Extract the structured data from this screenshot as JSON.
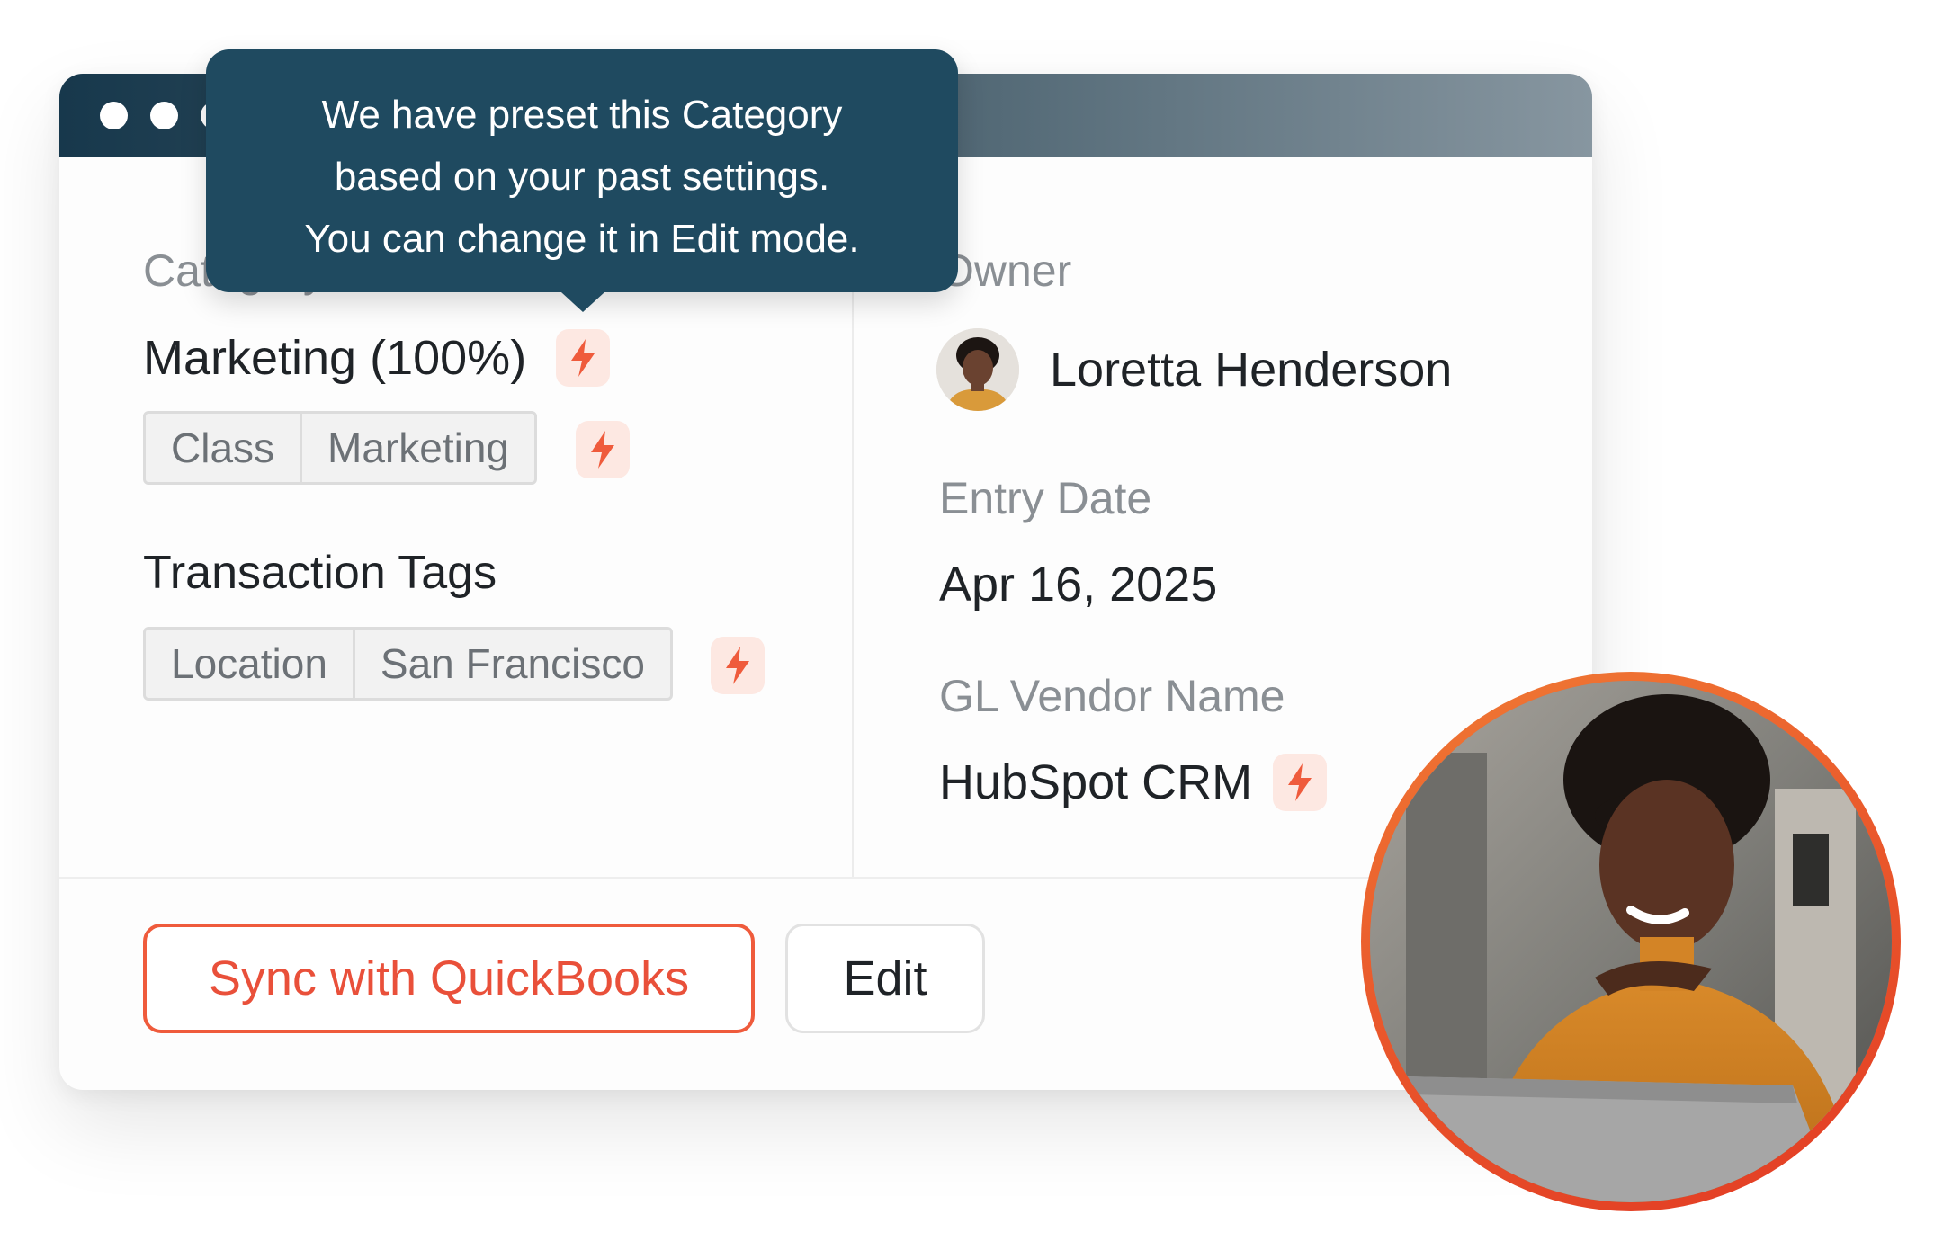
{
  "tooltip": {
    "line1": "We have preset this Category",
    "line2": "based on your past settings.",
    "line3": "You can change it in Edit mode."
  },
  "left": {
    "category_label": "Category",
    "category_value": "Marketing (100%)",
    "class_chip": {
      "key": "Class",
      "value": "Marketing"
    },
    "transaction_tags_title": "Transaction Tags",
    "location_chip": {
      "key": "Location",
      "value": "San Francisco"
    }
  },
  "right": {
    "owner_label": "Owner",
    "owner_name": "Loretta Henderson",
    "entry_date_label": "Entry Date",
    "entry_date_value": "Apr 16, 2025",
    "vendor_label": "GL Vendor Name",
    "vendor_value": "HubSpot CRM"
  },
  "actions": {
    "sync_label": "Sync with QuickBooks",
    "edit_label": "Edit"
  },
  "colors": {
    "accent": "#ef5b3c",
    "tooltip_bg": "#1f4a60",
    "titlebar": "#17384c",
    "bolt_bg": "#fde8e2"
  },
  "icons": [
    "lightning-bolt-icon",
    "avatar",
    "window-dots"
  ]
}
